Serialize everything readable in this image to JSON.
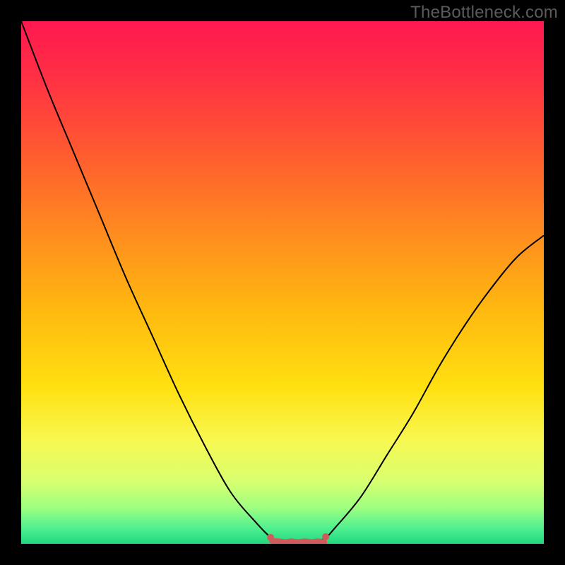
{
  "watermark": "TheBottleneck.com",
  "chart_data": {
    "type": "line",
    "title": "",
    "xlabel": "",
    "ylabel": "",
    "x": [
      0.0,
      0.05,
      0.1,
      0.15,
      0.2,
      0.25,
      0.3,
      0.35,
      0.4,
      0.45,
      0.48,
      0.5,
      0.52,
      0.55,
      0.58,
      0.6,
      0.65,
      0.7,
      0.75,
      0.8,
      0.85,
      0.9,
      0.95,
      1.0
    ],
    "values": [
      1.0,
      0.87,
      0.75,
      0.63,
      0.51,
      0.4,
      0.29,
      0.19,
      0.1,
      0.04,
      0.01,
      0.0,
      0.0,
      0.0,
      0.01,
      0.03,
      0.09,
      0.17,
      0.25,
      0.34,
      0.42,
      0.49,
      0.55,
      0.59
    ],
    "ylim": [
      0,
      1
    ],
    "xlim": [
      0,
      1
    ],
    "flat_region_x": [
      0.48,
      0.58
    ],
    "gradient_stops": [
      {
        "offset": 0.0,
        "color": "#ff1850"
      },
      {
        "offset": 0.1,
        "color": "#ff2e45"
      },
      {
        "offset": 0.25,
        "color": "#ff5a30"
      },
      {
        "offset": 0.4,
        "color": "#ff8a1f"
      },
      {
        "offset": 0.55,
        "color": "#ffb810"
      },
      {
        "offset": 0.7,
        "color": "#ffe010"
      },
      {
        "offset": 0.8,
        "color": "#f8f850"
      },
      {
        "offset": 0.88,
        "color": "#d8ff70"
      },
      {
        "offset": 0.93,
        "color": "#a0ff80"
      },
      {
        "offset": 0.97,
        "color": "#50f090"
      },
      {
        "offset": 1.0,
        "color": "#20d880"
      }
    ],
    "marker_color": "#d15a5a",
    "curve_color": "#000000"
  }
}
